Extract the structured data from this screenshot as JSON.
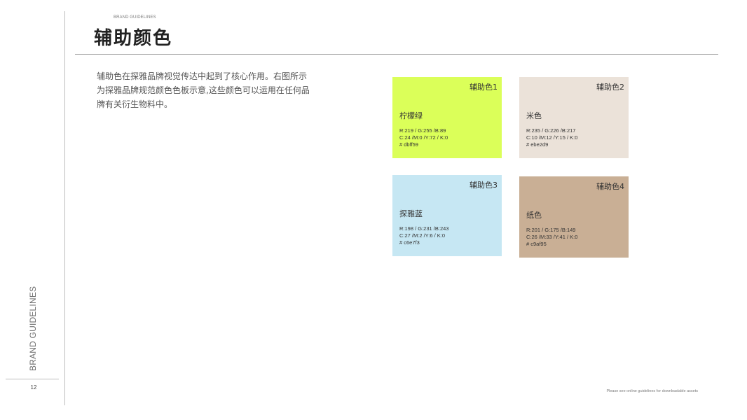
{
  "sidebar": {
    "vertical_label": "BRAND GUIDELINES",
    "page_number": "12"
  },
  "header": {
    "eyebrow": "BRAND GUIDELINES",
    "title": "辅助颜色"
  },
  "intro": {
    "text": "辅助色在探雅品牌视觉传达中起到了核心作用。右图所示为探雅品牌规范颜色色板示意,这些颜色可以运用在任何品牌有关衍生物料中。"
  },
  "swatches": [
    {
      "label": "辅助色1",
      "name": "柠檬绿",
      "rgb": "R:219 / G:255 /B:89",
      "cmyk": "C:24 /M:0 /Y:72 / K:0",
      "hex": "# dbff59",
      "color": "#dbff59"
    },
    {
      "label": "辅助色2",
      "name": "米色",
      "rgb": "R:235 / G:226 /B:217",
      "cmyk": "C:10 /M:12 /Y:15 / K:0",
      "hex": "# ebe2d9",
      "color": "#ebe2d9"
    },
    {
      "label": "辅助色3",
      "name": "探雅蓝",
      "rgb": "R:198 / G:231 /B:243",
      "cmyk": "C:27 /M:2 /Y:6 / K:0",
      "hex": "# c6e7f3",
      "color": "#c6e7f3"
    },
    {
      "label": "辅助色4",
      "name": "纸色",
      "rgb": "R:201 / G:175 /B:149",
      "cmyk": "C:26 /M:33 /Y:41 / K:0",
      "hex": "# c9af95",
      "color": "#c9af95"
    }
  ],
  "footer": {
    "note": "Please see online guidelines for downloadable assets"
  }
}
